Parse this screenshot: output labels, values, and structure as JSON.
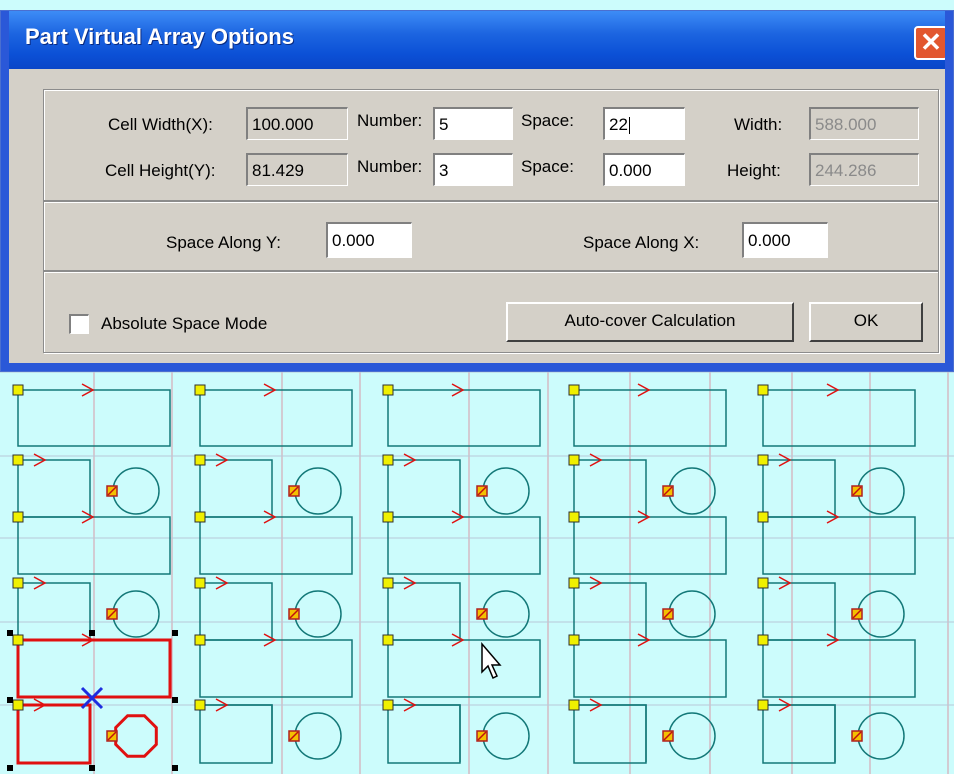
{
  "dialog": {
    "title": "Part Virtual Array Options",
    "close_glyph": "✕",
    "row1": {
      "cell_width_label": "Cell Width(X):",
      "cell_width_value": "100.000",
      "number_label": "Number:",
      "number_value": "5",
      "space_label": "Space:",
      "space_value": "22",
      "width_label": "Width:",
      "width_value": "588.000"
    },
    "row2": {
      "cell_height_label": "Cell Height(Y):",
      "cell_height_value": "81.429",
      "number_label": "Number:",
      "number_value": "3",
      "space_label": "Space:",
      "space_value": "0.000",
      "height_label": "Height:",
      "height_value": "244.286"
    },
    "space_along_y_label": "Space Along Y:",
    "space_along_y_value": "0.000",
    "space_along_x_label": "Space Along X:",
    "space_along_x_value": "0.000",
    "absolute_space_mode_label": "Absolute Space Mode",
    "absolute_space_mode_checked": false,
    "auto_cover_label": "Auto-cover Calculation",
    "ok_label": "OK"
  },
  "canvas": {
    "background": "#ccfcfc",
    "part_color": "#137878",
    "selected_color": "#e01010",
    "arrow_color": "#e01010",
    "start_marker_color": "#f0f000",
    "grid_color": "#d89aa8",
    "selection_marker": "blue-x-icon",
    "array_columns": 5,
    "array_rows": 3
  }
}
